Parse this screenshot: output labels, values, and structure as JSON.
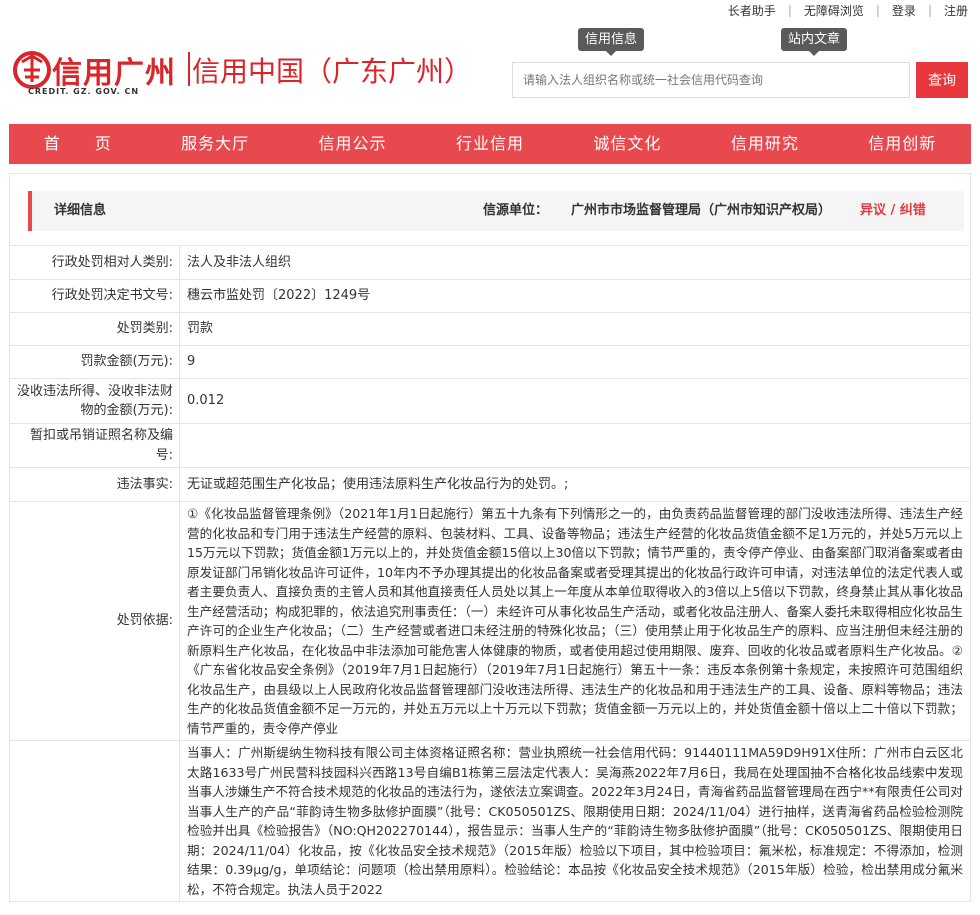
{
  "toplinks": [
    "长者助手",
    "无障碍浏览",
    "登录",
    "注册"
  ],
  "logo": {
    "main": "信用广州",
    "sub": "CREDIT. GZ. GOV. CN",
    "second": "信用中国（广东广州）",
    "mark_icon": "credit-seal-icon"
  },
  "search": {
    "tabs": [
      "信用信息",
      "站内文章"
    ],
    "placeholder": "请输入法人组织名称或统一社会信用代码查询",
    "button": "查询"
  },
  "nav": [
    "首　　页",
    "服务大厅",
    "信用公示",
    "行业信用",
    "诚信文化",
    "信用研究",
    "信用创新"
  ],
  "detail": {
    "title": "详细信息",
    "source_label": "信源单位：",
    "source": "广州市市场监督管理局（广州市知识产权局）",
    "objection": "异议 / 纠错"
  },
  "rows": [
    {
      "key": "行政处罚相对人类别:",
      "value": "法人及非法人组织"
    },
    {
      "key": "行政处罚决定书文号:",
      "value": "穗云市监处罚〔2022〕1249号"
    },
    {
      "key": "处罚类别:",
      "value": "罚款"
    },
    {
      "key": "罚款金额(万元):",
      "value": "9"
    },
    {
      "key": "没收违法所得、没收非法财物的金额(万元):",
      "value": "0.012"
    },
    {
      "key": "暂扣或吊销证照名称及编号:",
      "value": ""
    },
    {
      "key": "违法事实:",
      "value": "无证或超范围生产化妆品；使用违法原料生产化妆品行为的处罚。;"
    },
    {
      "key": "处罚依据:",
      "value": "①《化妆品监督管理条例》（2021年1月1日起施行）第五十九条有下列情形之一的，由负责药品监督管理的部门没收违法所得、违法生产经营的化妆品和专门用于违法生产经营的原料、包装材料、工具、设备等物品；违法生产经营的化妆品货值金额不足1万元的，并处5万元以上15万元以下罚款；货值金额1万元以上的，并处货值金额15倍以上30倍以下罚款；情节严重的，责令停产停业、由备案部门取消备案或者由原发证部门吊销化妆品许可证件，10年内不予办理其提出的化妆品备案或者受理其提出的化妆品行政许可申请，对违法单位的法定代表人或者主要负责人、直接负责的主管人员和其他直接责任人员处以其上一年度从本单位取得收入的3倍以上5倍以下罚款，终身禁止其从事化妆品生产经营活动；构成犯罪的，依法追究刑事责任：（一）未经许可从事化妆品生产活动，或者化妆品注册人、备案人委托未取得相应化妆品生产许可的企业生产化妆品；（二）生产经营或者进口未经注册的特殊化妆品；（三）使用禁止用于化妆品生产的原料、应当注册但未经注册的新原料生产化妆品，在化妆品中非法添加可能危害人体健康的物质，或者使用超过使用期限、废弃、回收的化妆品或者原料生产化妆品。②《广东省化妆品安全条例》（2019年7月1日起施行）（2019年7月1日起施行）第五十一条：违反本条例第十条规定，未按照许可范围组织化妆品生产，由县级以上人民政府化妆品监督管理部门没收违法所得、违法生产的化妆品和用于违法生产的工具、设备、原料等物品；违法生产的化妆品货值金额不足一万元的，并处五万元以上十万元以下罚款；货值金额一万元以上的，并处货值金额十倍以上二十倍以下罚款；情节严重的，责令停产停业"
    },
    {
      "key": "",
      "value": "当事人：广州斯缇纳生物科技有限公司主体资格证照名称：营业执照统一社会信用代码：91440111MA59D9H91X住所：广州市白云区北太路1633号广州民营科技园科兴西路13号自编B1栋第三层法定代表人：吴海燕2022年7月6日，我局在处理国抽不合格化妆品线索中发现当事人涉嫌生产不符合技术规范的化妆品的违法行为，遂依法立案调查。2022年3月24日，青海省药品监督管理局在西宁**有限责任公司对当事人生产的产品“菲韵诗生物多肽修护面膜”（批号：CK050501ZS、限期使用日期：2024/11/04）进行抽样，送青海省药品检验检测院检验并出具《检验报告》（NO:QH202270144），报告显示：当事人生产的“菲韵诗生物多肽修护面膜”（批号：CK050501ZS、限期使用日期：2024/11/04）化妆品，按《化妆品安全技术规范》（2015年版）检验以下项目，其中检验项目：氟米松，标准规定：不得添加，检测结果：0.39μg/g，单项结论：问题项（检出禁用原料）。检验结论：本品按《化妆品安全技术规范》（2015年版）检验，检出禁用成分氟米松，不符合规定。执法人员于2022"
    }
  ]
}
